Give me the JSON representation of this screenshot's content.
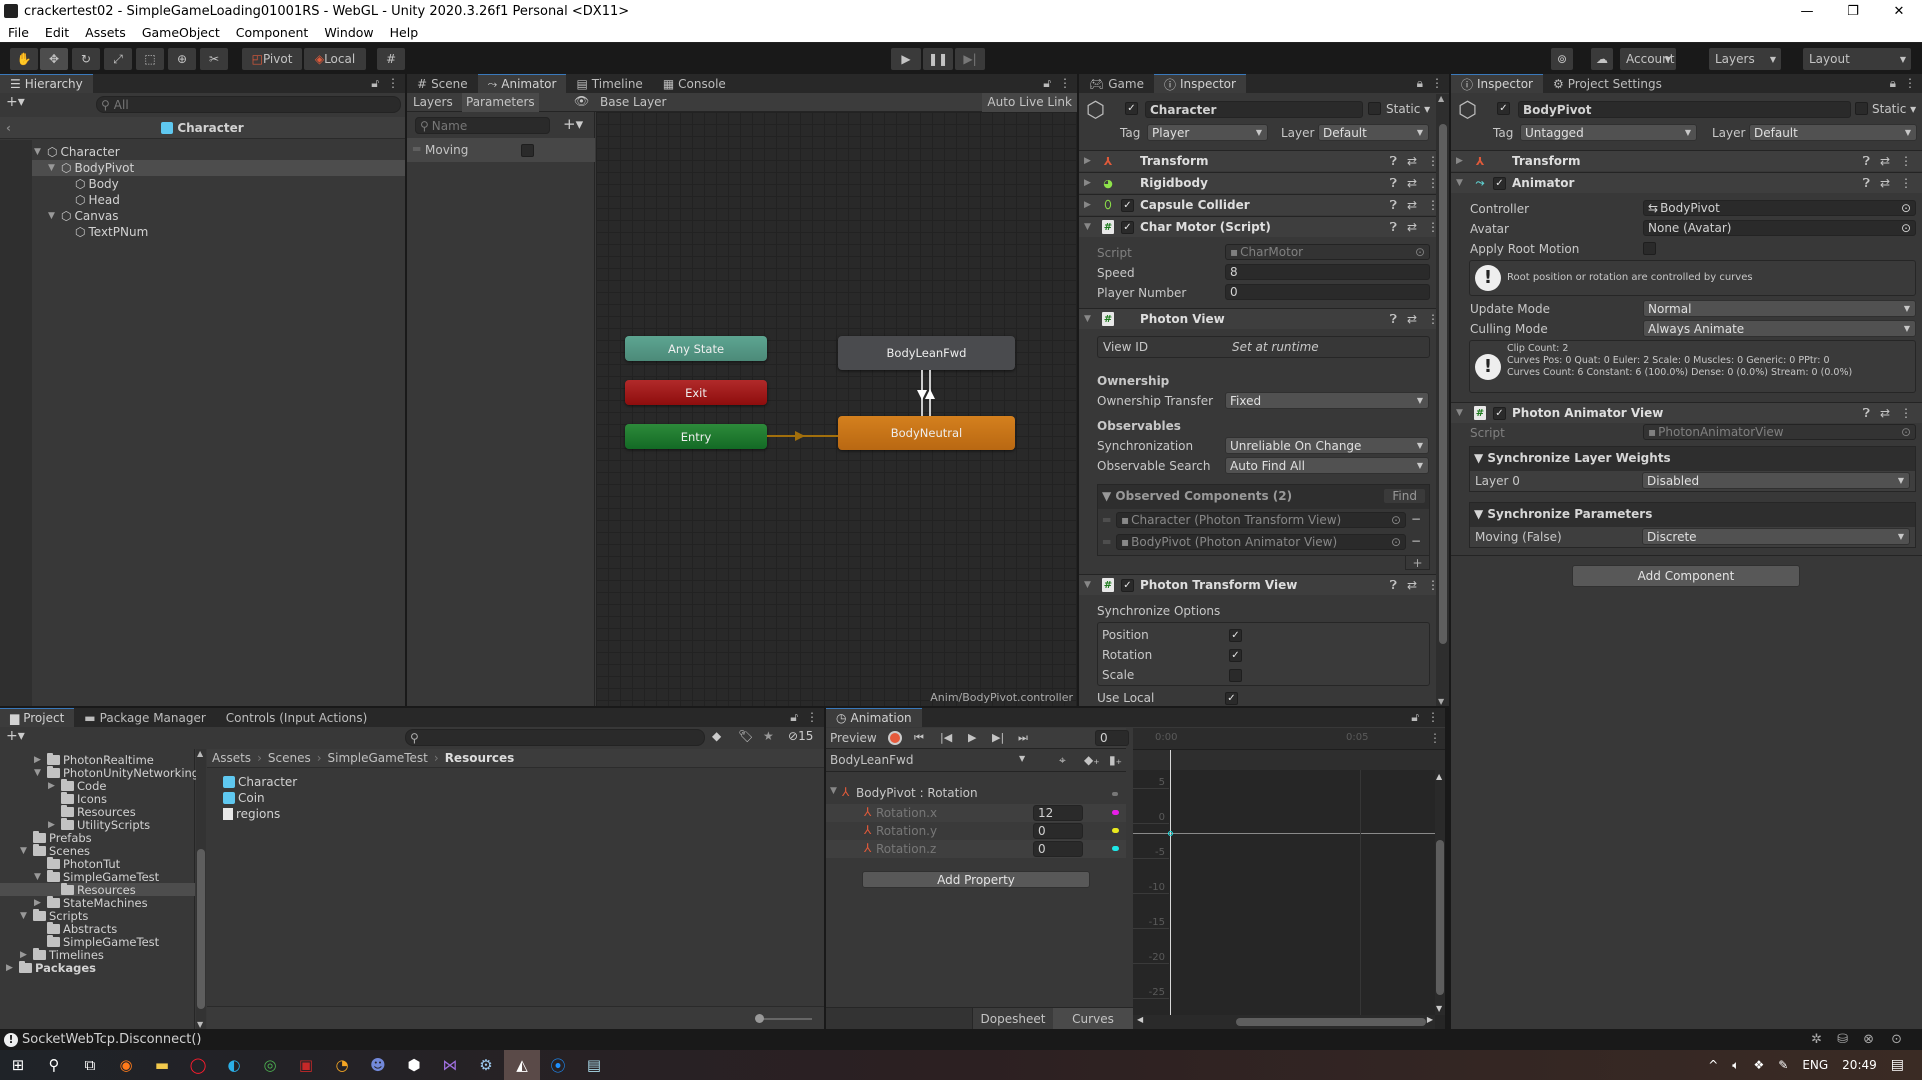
{
  "window": {
    "title": "crackertest02 - SimpleGameLoading01001RS - WebGL - Unity 2020.3.26f1 Personal <DX11>",
    "controls": [
      "—",
      "❐",
      "✕"
    ]
  },
  "menu": [
    "File",
    "Edit",
    "Assets",
    "GameObject",
    "Component",
    "Window",
    "Help"
  ],
  "toolbar": {
    "pivot": "Pivot",
    "local": "Local",
    "account": "Account",
    "layers": "Layers",
    "layout": "Layout"
  },
  "hierarchy": {
    "tab": "Hierarchy",
    "search_placeholder": "All",
    "prefab_header": "Character",
    "items": [
      {
        "label": "Character",
        "depth": 0,
        "expanded": true
      },
      {
        "label": "BodyPivot",
        "depth": 1,
        "expanded": true,
        "selected": true
      },
      {
        "label": "Body",
        "depth": 2
      },
      {
        "label": "Head",
        "depth": 2
      },
      {
        "label": "Canvas",
        "depth": 1,
        "expanded": true
      },
      {
        "label": "TextPNum",
        "depth": 2
      }
    ]
  },
  "animator": {
    "tabs": [
      "Scene",
      "Animator",
      "Timeline",
      "Console"
    ],
    "subtabs": [
      "Layers",
      "Parameters"
    ],
    "breadcrumb": "Base Layer",
    "auto_live_link": "Auto Live Link",
    "param_search_placeholder": "Name",
    "parameters": [
      {
        "name": "Moving",
        "value": false
      }
    ],
    "states": {
      "any_state": "Any State",
      "exit": "Exit",
      "entry": "Entry",
      "body_lean_fwd": "BodyLeanFwd",
      "body_neutral": "BodyNeutral"
    },
    "footer_path": "Anim/BodyPivot.controller"
  },
  "inspector1": {
    "tabs": [
      "Game",
      "Inspector"
    ],
    "object_name": "Character",
    "static_label": "Static",
    "tag_label": "Tag",
    "tag": "Player",
    "layer_label": "Layer",
    "layer": "Default",
    "components": {
      "transform": "Transform",
      "rigidbody": "Rigidbody",
      "capsule": "Capsule Collider",
      "charmotor": "Char Motor (Script)",
      "photonview": "Photon View",
      "ptv": "Photon Transform View"
    },
    "charmotor": {
      "script_label": "Script",
      "script": "CharMotor",
      "speed_label": "Speed",
      "speed": "8",
      "player_label": "Player Number",
      "player": "0"
    },
    "photonview": {
      "viewid_label": "View ID",
      "viewid": "Set at runtime",
      "ownership": "Ownership",
      "transfer_label": "Ownership Transfer",
      "transfer": "Fixed",
      "observables": "Observables",
      "sync_label": "Synchronization",
      "sync": "Unreliable On Change",
      "search_label": "Observable Search",
      "search": "Auto Find All",
      "observed_header": "Observed Components (2)",
      "find": "Find",
      "observed": [
        "Character (Photon Transform View)",
        "BodyPivot (Photon Animator View)"
      ]
    },
    "ptv": {
      "sync_options": "Synchronize Options",
      "position": "Position",
      "position_checked": true,
      "rotation": "Rotation",
      "rotation_checked": true,
      "scale": "Scale",
      "scale_checked": false,
      "use_local": "Use Local",
      "use_local_checked": true
    }
  },
  "inspector2": {
    "tabs": [
      "Inspector",
      "Project Settings"
    ],
    "object_name": "BodyPivot",
    "static_label": "Static",
    "tag_label": "Tag",
    "tag": "Untagged",
    "layer_label": "Layer",
    "layer": "Default",
    "transform": "Transform",
    "animator": "Animator",
    "controller_label": "Controller",
    "controller": "BodyPivot",
    "avatar_label": "Avatar",
    "avatar": "None (Avatar)",
    "root_motion_label": "Apply Root Motion",
    "root_info": "Root position or rotation are controlled by curves",
    "update_label": "Update Mode",
    "update": "Normal",
    "culling_label": "Culling Mode",
    "culling": "Always Animate",
    "clip_info": [
      "Clip Count: 2",
      "Curves Pos: 0 Quat: 0 Euler: 2 Scale: 0 Muscles: 0 Generic: 0 PPtr: 0",
      "Curves Count: 6 Constant: 6 (100.0%) Dense: 0 (0.0%) Stream: 0 (0.0%)"
    ],
    "pav": "Photon Animator View",
    "pav_script_label": "Script",
    "pav_script": "PhotonAnimatorView",
    "sync_layers": "Synchronize Layer Weights",
    "layer0": "Layer 0",
    "layer0_value": "Disabled",
    "sync_params": "Synchronize Parameters",
    "moving": "Moving (False)",
    "moving_value": "Discrete",
    "add_component": "Add Component"
  },
  "project": {
    "tabs": [
      "Project",
      "Package Manager",
      "Controls (Input Actions)"
    ],
    "hidden_count": "15",
    "tree": [
      {
        "label": "PhotonRealtime",
        "depth": 2,
        "arrow": "right"
      },
      {
        "label": "PhotonUnityNetworking",
        "depth": 2,
        "arrow": "down"
      },
      {
        "label": "Code",
        "depth": 3,
        "arrow": "right"
      },
      {
        "label": "Icons",
        "depth": 3
      },
      {
        "label": "Resources",
        "depth": 3
      },
      {
        "label": "UtilityScripts",
        "depth": 3,
        "arrow": "right"
      },
      {
        "label": "Prefabs",
        "depth": 1
      },
      {
        "label": "Scenes",
        "depth": 1,
        "arrow": "down"
      },
      {
        "label": "PhotonTut",
        "depth": 2
      },
      {
        "label": "SimpleGameTest",
        "depth": 2,
        "arrow": "down"
      },
      {
        "label": "Resources",
        "depth": 3,
        "selected": true
      },
      {
        "label": "StateMachines",
        "depth": 2,
        "arrow": "right"
      },
      {
        "label": "Scripts",
        "depth": 1,
        "arrow": "down"
      },
      {
        "label": "Abstracts",
        "depth": 2
      },
      {
        "label": "SimpleGameTest",
        "depth": 2
      },
      {
        "label": "Timelines",
        "depth": 1,
        "arrow": "right"
      },
      {
        "label": "Packages",
        "depth": 0,
        "arrow": "right",
        "bold": true
      }
    ],
    "breadcrumb": [
      "Assets",
      "Scenes",
      "SimpleGameTest",
      "Resources"
    ],
    "files": [
      {
        "label": "Character",
        "type": "prefab"
      },
      {
        "label": "Coin",
        "type": "prefab"
      },
      {
        "label": "regions",
        "type": "text"
      }
    ]
  },
  "animation": {
    "tab": "Animation",
    "preview": "Preview",
    "frame": "0",
    "clip": "BodyLeanFwd",
    "property_group": "BodyPivot : Rotation",
    "properties": [
      {
        "name": "Rotation.x",
        "value": "12",
        "color": "#e81ee8"
      },
      {
        "name": "Rotation.y",
        "value": "0",
        "color": "#e8e81e"
      },
      {
        "name": "Rotation.z",
        "value": "0",
        "color": "#1ee8e8"
      }
    ],
    "add_property": "Add Property",
    "dopesheet": "Dopesheet",
    "curves": "Curves",
    "time_labels": [
      "0:00",
      "0:05"
    ],
    "y_labels": [
      "5",
      "0",
      "-5",
      "-10",
      "-15",
      "-20",
      "-25"
    ]
  },
  "status": {
    "message": "SocketWebTcp.Disconnect()"
  },
  "taskbar": {
    "lang": "ENG",
    "time": "20:49"
  }
}
